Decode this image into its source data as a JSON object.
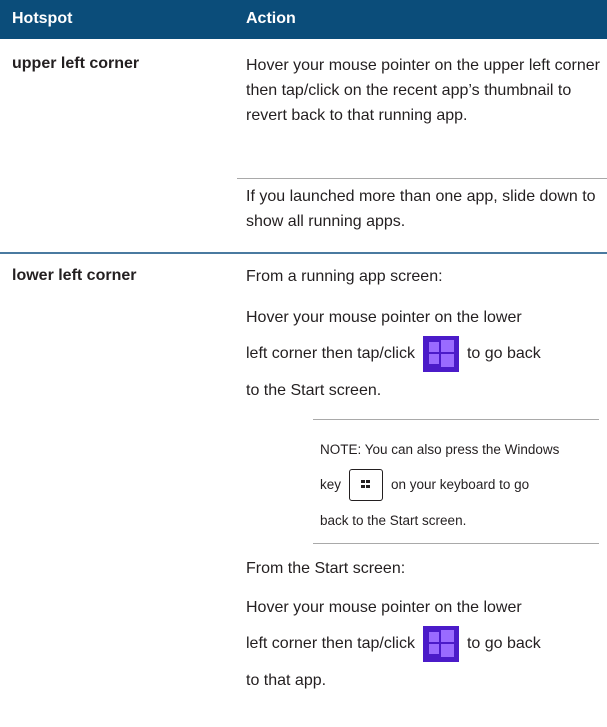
{
  "header": {
    "col1": "Hotspot",
    "col2": "Action"
  },
  "row1": {
    "hotspot": "upper left corner",
    "action1": "Hover your mouse pointer on the upper left corner then tap/click on the recent app’s thumbnail to revert back to that running app.",
    "action2": "If you launched more than one app, slide down to show all running apps."
  },
  "row2": {
    "hotspot": "lower left corner",
    "from_app": "From a running app screen:",
    "hover1_line1": "Hover your mouse pointer on the lower",
    "hover1_line2a": "left corner then tap/click",
    "hover1_line2b": "to go back",
    "hover1_line3": "to the Start screen.",
    "note_line1": "NOTE: You can also press the Windows",
    "note_key_before": "key",
    "note_key_after": "on your keyboard to go",
    "note_line3": "back to the Start screen.",
    "from_start": "From the Start screen:",
    "hover2_line1": "Hover your mouse pointer on the lower",
    "hover2_line2a": "left corner then tap/click",
    "hover2_line2b": "to go back",
    "hover2_line3": "to that app."
  },
  "colors": {
    "header_bg": "#0b4d7a",
    "windows_tile": "#4b1bc9"
  },
  "icons": {
    "start_button": "windows-logo-icon",
    "windows_key": "windows-key-icon"
  }
}
